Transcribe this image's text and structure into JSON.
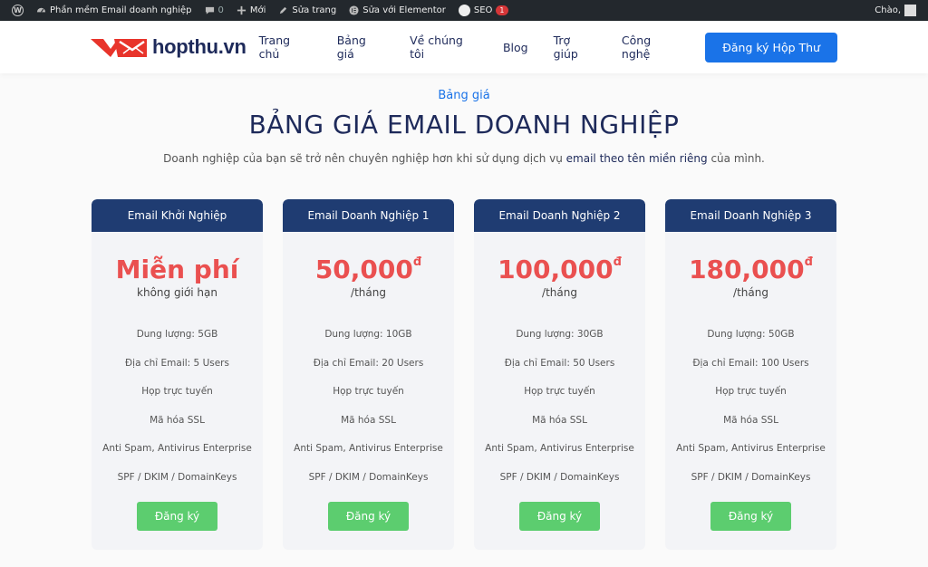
{
  "adminbar": {
    "site_name": "Phần mềm Email doanh nghiệp",
    "comments_count": "0",
    "new_label": "Mới",
    "edit_page_label": "Sửa trang",
    "elementor_label": "Sửa với Elementor",
    "seo_label": "SEO",
    "seo_badge": "1",
    "greeting": "Chào,"
  },
  "header": {
    "logo_text": "hopthu.vn",
    "nav": [
      "Trang chủ",
      "Bảng giá",
      "Về chúng tôi",
      "Blog",
      "Trợ giúp",
      "Công nghệ"
    ],
    "cta_label": "Đăng ký Hộp Thư"
  },
  "section": {
    "kicker": "Bảng giá",
    "title": "BẢNG GIÁ EMAIL DOANH NGHIỆP",
    "subtitle_pre": "Doanh nghiệp của bạn sẽ trở nên chuyên nghiệp hơn khi sử dụng dịch vụ ",
    "subtitle_bold": "email theo tên miền riêng",
    "subtitle_post": " của mình."
  },
  "plans": [
    {
      "name": "Email Khởi Nghiệp",
      "price": "Miễn phí",
      "currency": "",
      "period": "không giới hạn",
      "features": [
        "Dung lượng: 5GB",
        "Địa chỉ Email: 5 Users",
        "Họp trực tuyến",
        "Mã hóa SSL",
        "Anti Spam, Antivirus Enterprise",
        "SPF / DKIM / DomainKeys"
      ],
      "button": "Đăng ký"
    },
    {
      "name": "Email Doanh Nghiệp 1",
      "price": "50,000",
      "currency": "đ",
      "period": "/tháng",
      "features": [
        "Dung lượng: 10GB",
        "Địa chỉ Email: 20 Users",
        "Họp trực tuyến",
        "Mã hóa SSL",
        "Anti Spam, Antivirus Enterprise",
        "SPF / DKIM / DomainKeys"
      ],
      "button": "Đăng ký"
    },
    {
      "name": "Email Doanh Nghiệp 2",
      "price": "100,000",
      "currency": "đ",
      "period": "/tháng",
      "features": [
        "Dung lượng: 30GB",
        "Địa chỉ Email: 50 Users",
        "Họp trực tuyến",
        "Mã hóa SSL",
        "Anti Spam, Antivirus Enterprise",
        "SPF / DKIM / DomainKeys"
      ],
      "button": "Đăng ký"
    },
    {
      "name": "Email Doanh Nghiệp 3",
      "price": "180,000",
      "currency": "đ",
      "period": "/tháng",
      "features": [
        "Dung lượng: 50GB",
        "Địa chỉ Email: 100 Users",
        "Họp trực tuyến",
        "Mã hóa SSL",
        "Anti Spam, Antivirus Enterprise",
        "SPF / DKIM / DomainKeys"
      ],
      "button": "Đăng ký"
    }
  ],
  "colors": {
    "brand_blue": "#1a73e8",
    "card_header": "#1f3c72",
    "price_red": "#ea5050",
    "signup_green": "#5ccd6f"
  }
}
